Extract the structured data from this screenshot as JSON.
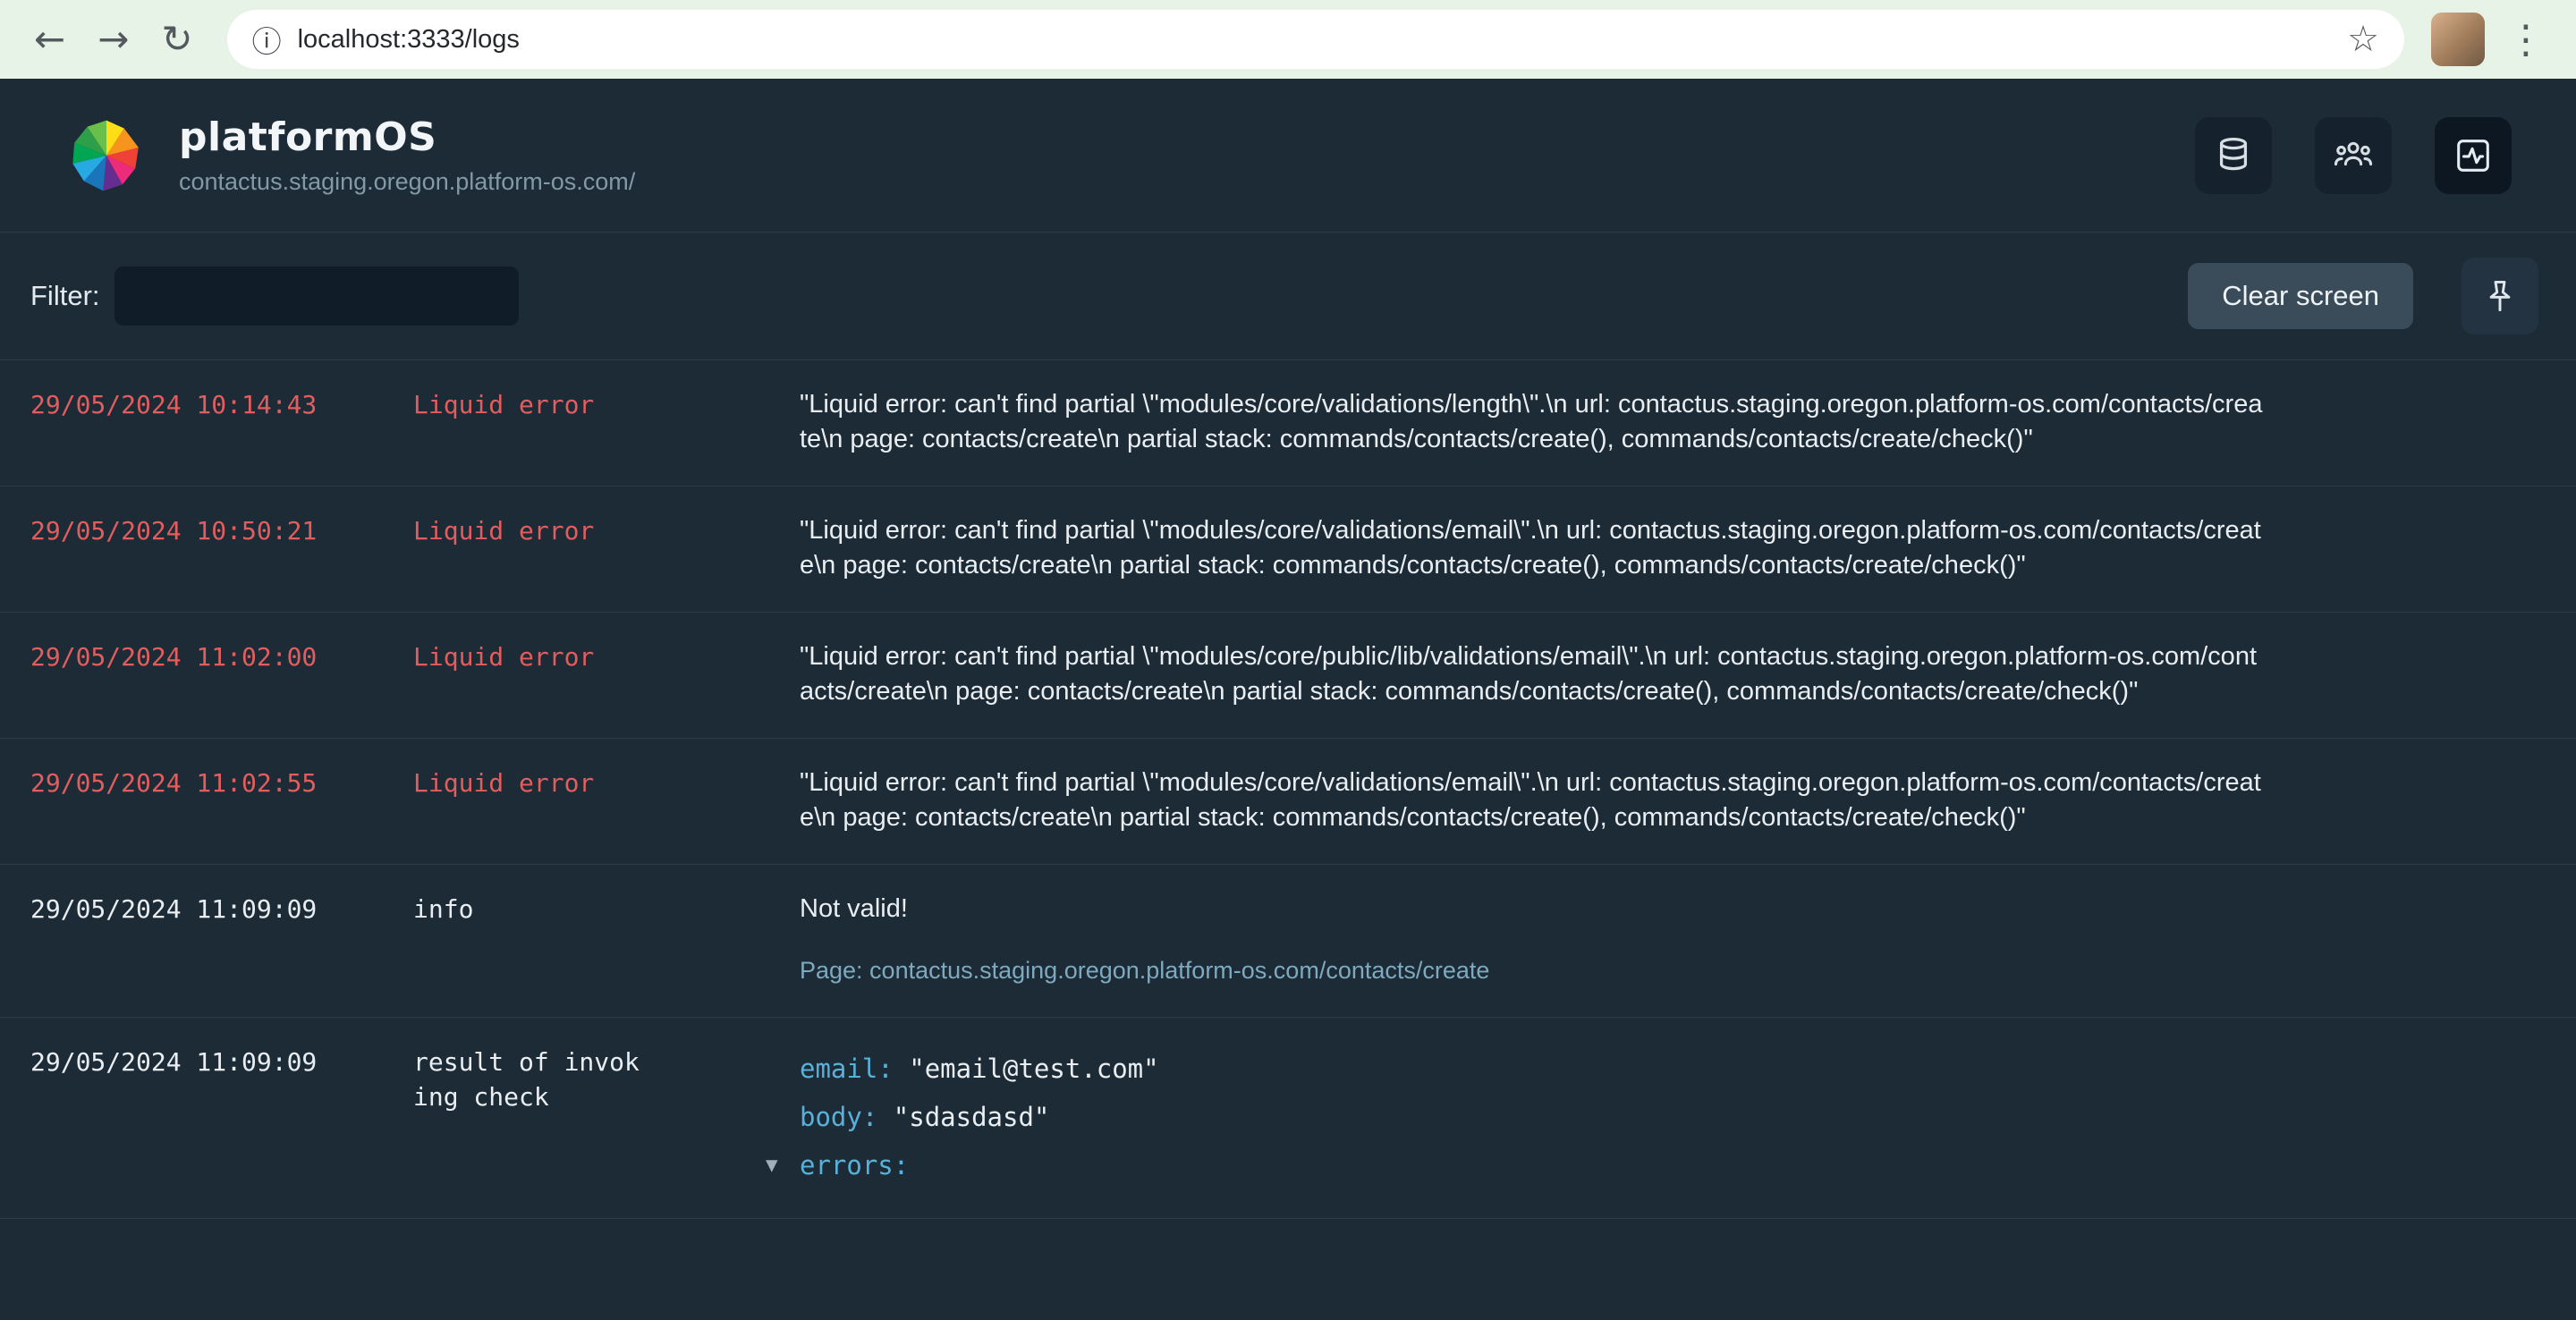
{
  "browser": {
    "url": "localhost:3333/logs",
    "back_icon": "←",
    "forward_icon": "→",
    "reload_icon": "↻",
    "info_icon": "ⓘ",
    "star_icon": "☆",
    "menu_icon": "⋮"
  },
  "header": {
    "app_name": "platformOS",
    "instance_url": "contactus.staging.oregon.platform-os.com/"
  },
  "toolbar": {
    "filter_label": "Filter:",
    "filter_value": "",
    "clear_button": "Clear screen"
  },
  "icons": {
    "caret": "▾"
  },
  "colors": {
    "background": "#1d2b37",
    "error_text": "#e25d5d",
    "normal_text": "#e9eef2",
    "key_blue": "#58b1da",
    "link_teal": "#7fa9be",
    "chrome_green": "#e7f3e6"
  },
  "logs": [
    {
      "time": "29/05/2024 10:14:43",
      "type": "Liquid error",
      "level": "error",
      "message": "\"Liquid error: can't find partial \\\"modules/core/validations/length\\\".\\n url: contactus.staging.oregon.platform-os.com/contacts/create\\n page: contacts/create\\n partial stack: commands/contacts/create(), commands/contacts/create/check()\""
    },
    {
      "time": "29/05/2024 10:50:21",
      "type": "Liquid error",
      "level": "error",
      "message": "\"Liquid error: can't find partial \\\"modules/core/validations/email\\\".\\n url: contactus.staging.oregon.platform-os.com/contacts/create\\n page: contacts/create\\n partial stack: commands/contacts/create(), commands/contacts/create/check()\""
    },
    {
      "time": "29/05/2024 11:02:00",
      "type": "Liquid error",
      "level": "error",
      "message": "\"Liquid error: can't find partial \\\"modules/core/public/lib/validations/email\\\".\\n url: contactus.staging.oregon.platform-os.com/contacts/create\\n page: contacts/create\\n partial stack: commands/contacts/create(), commands/contacts/create/check()\""
    },
    {
      "time": "29/05/2024 11:02:55",
      "type": "Liquid error",
      "level": "error",
      "message": "\"Liquid error: can't find partial \\\"modules/core/validations/email\\\".\\n url: contactus.staging.oregon.platform-os.com/contacts/create\\n page: contacts/create\\n partial stack: commands/contacts/create(), commands/contacts/create/check()\""
    },
    {
      "time": "29/05/2024 11:09:09",
      "type": "info",
      "level": "info",
      "message": "Not valid!",
      "link": "Page: contactus.staging.oregon.platform-os.com/contacts/create"
    },
    {
      "time": "29/05/2024 11:09:09",
      "type": "result of invoking check",
      "level": "info",
      "kv": [
        {
          "key": "email:",
          "value": "\"email@test.com\""
        },
        {
          "key": "body:",
          "value": "\"sdasdasd\""
        }
      ],
      "expand_label": "errors:"
    }
  ]
}
